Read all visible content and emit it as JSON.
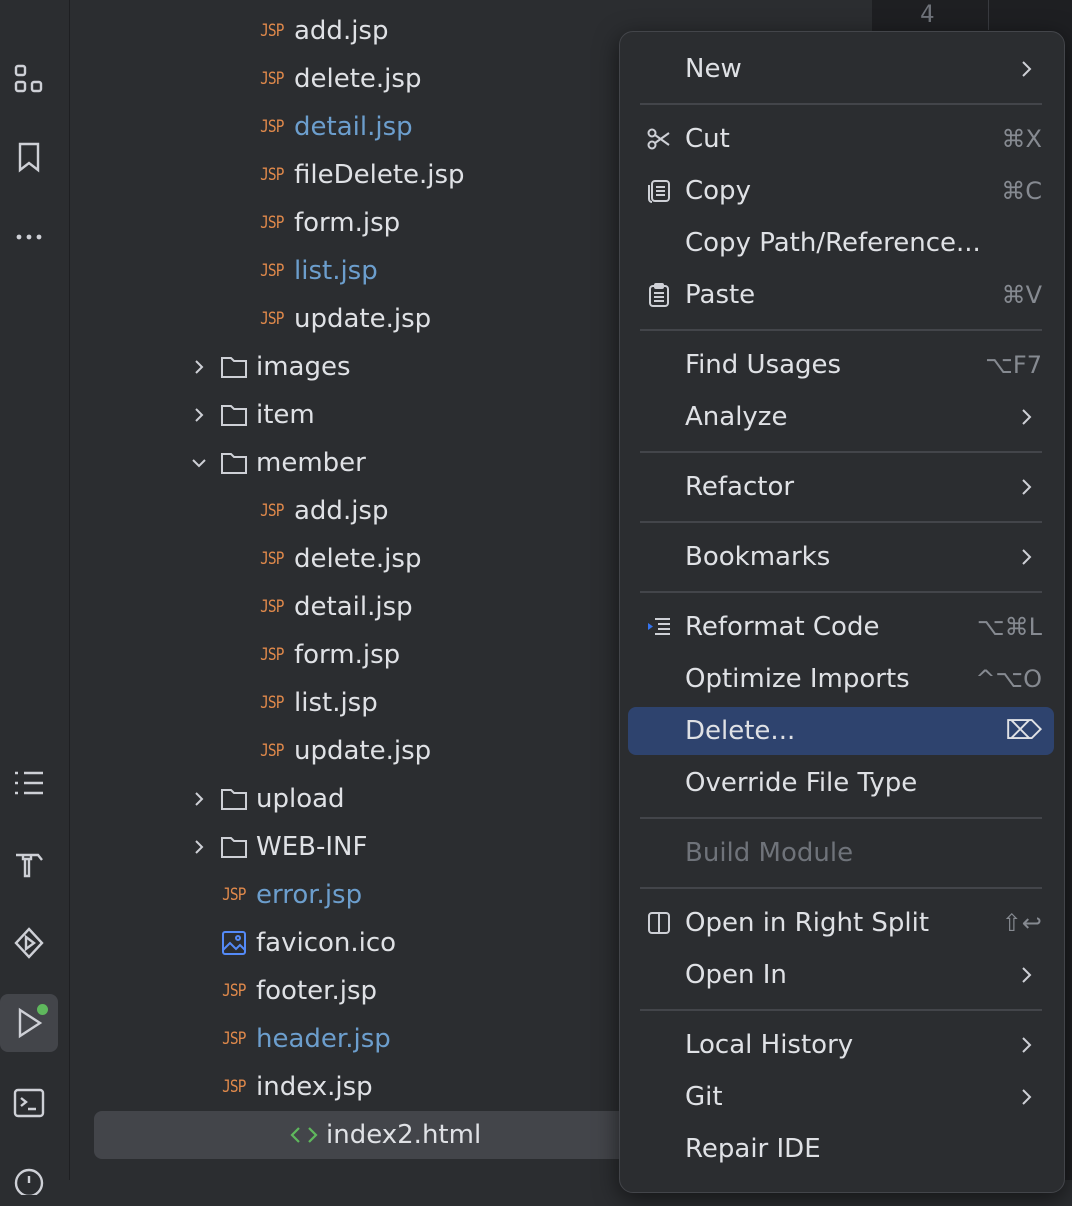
{
  "editor": {
    "line_number": "4"
  },
  "tree": {
    "items": [
      {
        "label": "add.jsp",
        "type": "jsp",
        "modified": false
      },
      {
        "label": "delete.jsp",
        "type": "jsp",
        "modified": false
      },
      {
        "label": "detail.jsp",
        "type": "jsp",
        "modified": true
      },
      {
        "label": "fileDelete.jsp",
        "type": "jsp",
        "modified": false
      },
      {
        "label": "form.jsp",
        "type": "jsp",
        "modified": false
      },
      {
        "label": "list.jsp",
        "type": "jsp",
        "modified": true
      },
      {
        "label": "update.jsp",
        "type": "jsp",
        "modified": false
      },
      {
        "label": "images",
        "type": "folder",
        "expanded": false
      },
      {
        "label": "item",
        "type": "folder",
        "expanded": false
      },
      {
        "label": "member",
        "type": "folder",
        "expanded": true
      },
      {
        "label": "add.jsp",
        "type": "jsp",
        "modified": false
      },
      {
        "label": "delete.jsp",
        "type": "jsp",
        "modified": false
      },
      {
        "label": "detail.jsp",
        "type": "jsp",
        "modified": false
      },
      {
        "label": "form.jsp",
        "type": "jsp",
        "modified": false
      },
      {
        "label": "list.jsp",
        "type": "jsp",
        "modified": false
      },
      {
        "label": "update.jsp",
        "type": "jsp",
        "modified": false
      },
      {
        "label": "upload",
        "type": "folder",
        "expanded": false
      },
      {
        "label": "WEB-INF",
        "type": "folder",
        "expanded": false
      },
      {
        "label": "error.jsp",
        "type": "jsp",
        "modified": true
      },
      {
        "label": "favicon.ico",
        "type": "image",
        "modified": false
      },
      {
        "label": "footer.jsp",
        "type": "jsp",
        "modified": false
      },
      {
        "label": "header.jsp",
        "type": "jsp",
        "modified": true
      },
      {
        "label": "index.jsp",
        "type": "jsp",
        "modified": false
      },
      {
        "label": "index2.html",
        "type": "html",
        "modified": false,
        "selected": true
      }
    ],
    "jsp_badge": "JSP"
  },
  "menu": {
    "items": [
      {
        "label": "New",
        "shortcut": "",
        "submenu": true,
        "icon": ""
      },
      {
        "label": "Cut",
        "shortcut": "⌘X",
        "submenu": false,
        "icon": "scissors-icon"
      },
      {
        "label": "Copy",
        "shortcut": "⌘C",
        "submenu": false,
        "icon": "copy-icon"
      },
      {
        "label": "Copy Path/Reference...",
        "shortcut": "",
        "submenu": false,
        "icon": ""
      },
      {
        "label": "Paste",
        "shortcut": "⌘V",
        "submenu": false,
        "icon": "paste-icon"
      },
      {
        "label": "Find Usages",
        "shortcut": "⌥F7",
        "submenu": false,
        "icon": ""
      },
      {
        "label": "Analyze",
        "shortcut": "",
        "submenu": true,
        "icon": ""
      },
      {
        "label": "Refactor",
        "shortcut": "",
        "submenu": true,
        "icon": ""
      },
      {
        "label": "Bookmarks",
        "shortcut": "",
        "submenu": true,
        "icon": ""
      },
      {
        "label": "Reformat Code",
        "shortcut": "⌥⌘L",
        "submenu": false,
        "icon": "reformat-icon"
      },
      {
        "label": "Optimize Imports",
        "shortcut": "^⌥O",
        "submenu": false,
        "icon": ""
      },
      {
        "label": "Delete...",
        "shortcut": "⌦",
        "submenu": false,
        "icon": "",
        "highlighted": true
      },
      {
        "label": "Override File Type",
        "shortcut": "",
        "submenu": false,
        "icon": ""
      },
      {
        "label": "Build Module",
        "shortcut": "",
        "submenu": false,
        "icon": "",
        "disabled": true
      },
      {
        "label": "Open in Right Split",
        "shortcut": "⇧↩",
        "submenu": false,
        "icon": "split-icon"
      },
      {
        "label": "Open In",
        "shortcut": "",
        "submenu": true,
        "icon": ""
      },
      {
        "label": "Local History",
        "shortcut": "",
        "submenu": true,
        "icon": ""
      },
      {
        "label": "Git",
        "shortcut": "",
        "submenu": true,
        "icon": ""
      },
      {
        "label": "Repair IDE",
        "shortcut": "",
        "submenu": false,
        "icon": ""
      }
    ]
  },
  "toolstrip": {
    "icons": [
      "structure-icon",
      "bookmark-icon",
      "more-icon",
      "todo-list-icon",
      "build-icon",
      "services-icon",
      "run-icon",
      "terminal-icon",
      "problems-icon"
    ]
  },
  "colors": {
    "accent": "#2e436e",
    "modified_file": "#6c9ecd",
    "jsp_badge": "#e0894b",
    "run_indicator": "#5fb85d"
  }
}
